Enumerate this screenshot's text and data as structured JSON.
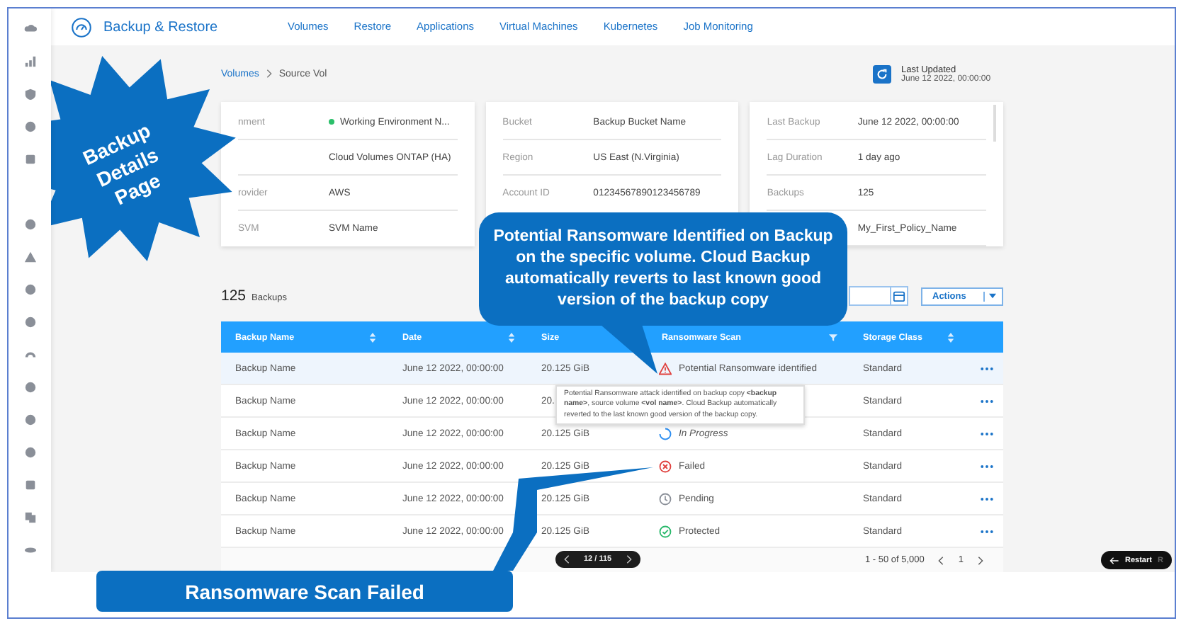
{
  "header": {
    "app_title": "Backup & Restore",
    "tabs": [
      {
        "label": "Volumes",
        "selected": false
      },
      {
        "label": "Restore",
        "selected": false
      },
      {
        "label": "Applications",
        "selected": false
      },
      {
        "label": "Virtual Machines",
        "selected": false
      },
      {
        "label": "Kubernetes",
        "selected": false
      },
      {
        "label": "Job Monitoring",
        "selected": false
      }
    ]
  },
  "breadcrumb": [
    "Volumes",
    "Source Vol"
  ],
  "last_updated": {
    "label": "Last Updated",
    "value": "June 12 2022, 00:00:00"
  },
  "cards": [
    {
      "rows": [
        {
          "label": "nment",
          "value": "Working Environment N...",
          "color": "#2bbf6a"
        },
        {
          "value": "Cloud Volumes ONTAP (HA)"
        },
        {
          "label": "rovider",
          "value": "AWS"
        },
        {
          "label": "SVM",
          "value": "SVM Name"
        }
      ]
    },
    {
      "rows": [
        {
          "label": "Bucket",
          "value": "Backup Bucket Name"
        },
        {
          "label": "Region",
          "value": "US East (N.Virginia)"
        },
        {
          "label": "Account ID",
          "value": "01234567890123456789"
        }
      ]
    },
    {
      "rows": [
        {
          "label": "Last Backup",
          "value": "June 12 2022, 00:00:00"
        },
        {
          "label": "Lag Duration",
          "value": "1 day ago"
        },
        {
          "label": "Backups",
          "value": "125"
        },
        {
          "value": "My_First_Policy_Name"
        }
      ]
    }
  ],
  "backups": {
    "count": "125",
    "label": "Backups",
    "actions": "Actions",
    "columns": [
      {
        "label": "Backup Name",
        "sortable": true
      },
      {
        "label": "Date",
        "sortable": true
      },
      {
        "label": "Size"
      },
      {
        "label": "Ransomware Scan",
        "filterable": true
      },
      {
        "label": "Storage Class",
        "sortable": true
      }
    ],
    "rows": [
      {
        "name": "Backup Name",
        "date": "June 12 2022, 00:00:00",
        "size": "20.125 GiB",
        "scan": {
          "kind": "warning",
          "label": "Potential Ransomware identified"
        },
        "storage": "Standard",
        "selected": true
      },
      {
        "name": "Backup Name",
        "date": "June 12 2022, 00:00:00",
        "size": "20.",
        "storage": "Standard",
        "selected": false
      },
      {
        "name": "Backup Name",
        "date": "June 12 2022, 00:00:00",
        "size": "20.125 GiB",
        "scan": {
          "kind": "progress",
          "label": "In Progress"
        },
        "storage": "Standard",
        "selected": false
      },
      {
        "name": "Backup Name",
        "date": "June 12 2022, 00:00:00",
        "size": "20.125 GiB",
        "scan": {
          "kind": "failed",
          "label": "Failed"
        },
        "storage": "Standard",
        "selected": false
      },
      {
        "name": "Backup Name",
        "date": "June 12 2022, 00:00:00",
        "size": "20.125 GiB",
        "scan": {
          "kind": "pending",
          "label": "Pending"
        },
        "storage": "Standard",
        "selected": false
      },
      {
        "name": "Backup Name",
        "date": "June 12 2022, 00:00:00",
        "size": "20.125 GiB",
        "scan": {
          "kind": "protected",
          "label": "Protected"
        },
        "storage": "Standard",
        "selected": false
      }
    ],
    "tooltip": "Potential Ransomware attack identified on backup copy **<backup name>**, source volume **<vol name>**. Cloud Backup automatically reverted to the last known good version of the backup copy.",
    "pager": "12 / 115",
    "range": "1 - 50 of 5,000",
    "page": "1"
  },
  "restart": {
    "label": "Restart",
    "shortcut": "R"
  },
  "annotations": {
    "burst": [
      "Backup Details",
      "Page"
    ],
    "callout": "Potential Ransomware Identified on Backup on the specific volume. Cloud Backup automatically reverts to last known good version of the backup copy",
    "banner": "Ransomware Scan Failed"
  }
}
